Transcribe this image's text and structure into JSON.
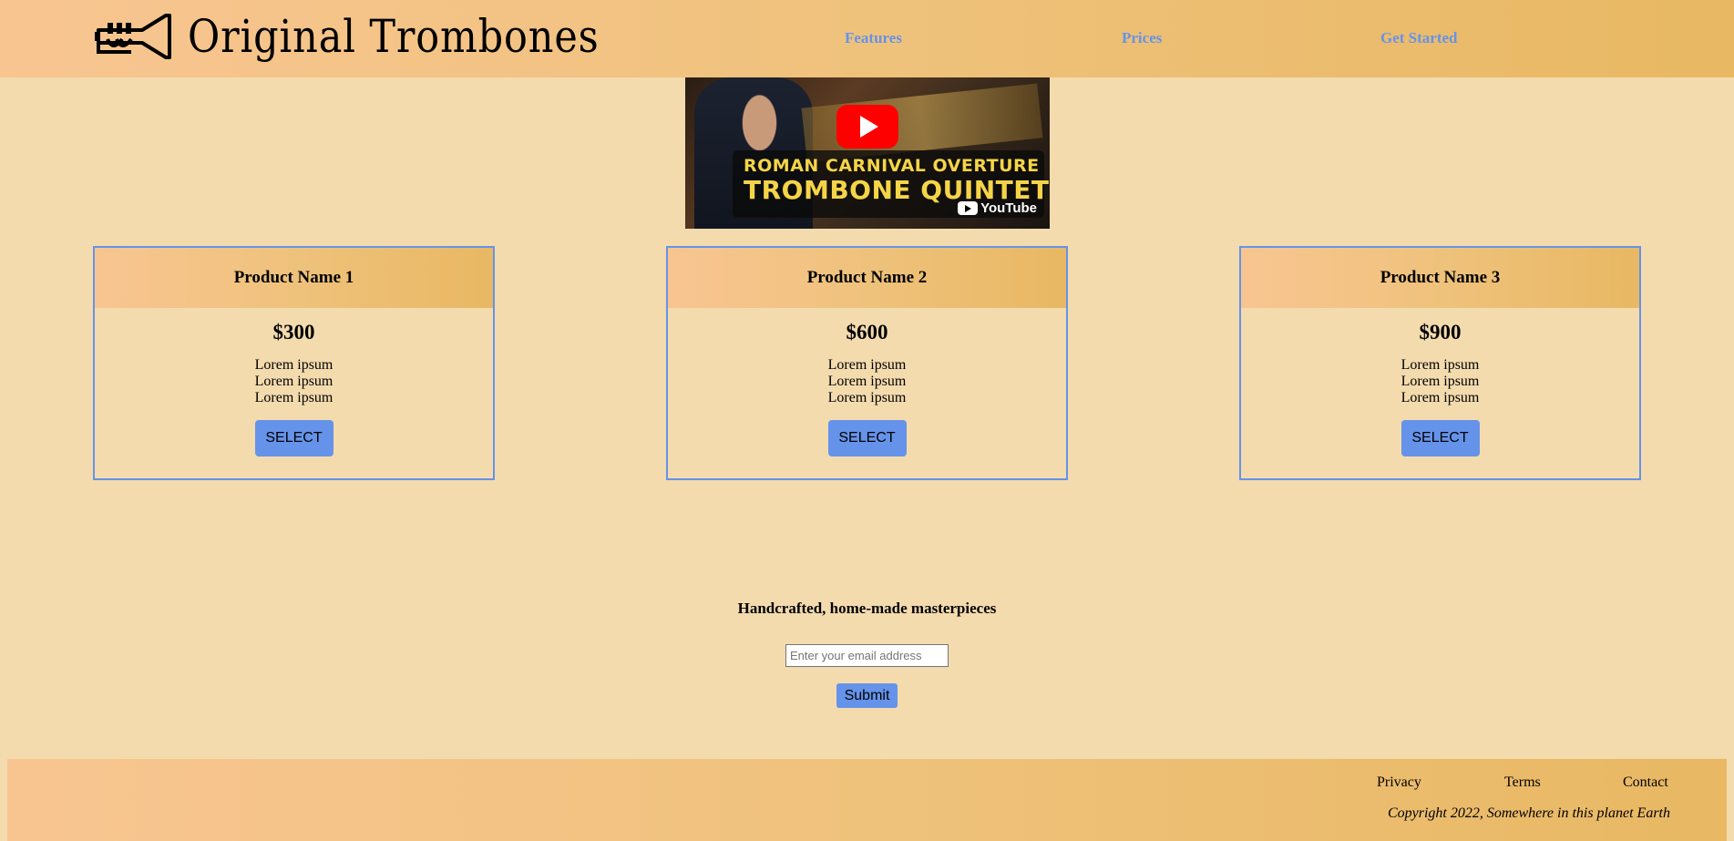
{
  "header": {
    "brand": "Original Trombones",
    "logo_icon": "trumpet-icon",
    "nav": [
      {
        "label": "Features"
      },
      {
        "label": "Prices"
      },
      {
        "label": "Get Started"
      }
    ]
  },
  "video": {
    "title_line1": "ROMAN CARNIVAL OVERTURE",
    "title_line2": "TROMBONE QUINTET",
    "watermark": "YouTube",
    "play_icon": "play-icon"
  },
  "products": [
    {
      "name": "Product Name 1",
      "price": "$300",
      "features": [
        "Lorem ipsum",
        "Lorem ipsum",
        "Lorem ipsum"
      ],
      "button": "SELECT"
    },
    {
      "name": "Product Name 2",
      "price": "$600",
      "features": [
        "Lorem ipsum",
        "Lorem ipsum",
        "Lorem ipsum"
      ],
      "button": "SELECT"
    },
    {
      "name": "Product Name 3",
      "price": "$900",
      "features": [
        "Lorem ipsum",
        "Lorem ipsum",
        "Lorem ipsum"
      ],
      "button": "SELECT"
    }
  ],
  "signup": {
    "tagline": "Handcrafted, home-made masterpieces",
    "email_placeholder": "Enter your email address",
    "submit_label": "Submit"
  },
  "footer": {
    "links": [
      {
        "label": "Privacy"
      },
      {
        "label": "Terms"
      },
      {
        "label": "Contact"
      }
    ],
    "copyright": "Copyright 2022, Somewhere in this planet Earth"
  },
  "colors": {
    "background": "#f3dbae",
    "accent": "#6593ea",
    "header_gradient_start": "#f8c591",
    "header_gradient_end": "#e8b863"
  }
}
